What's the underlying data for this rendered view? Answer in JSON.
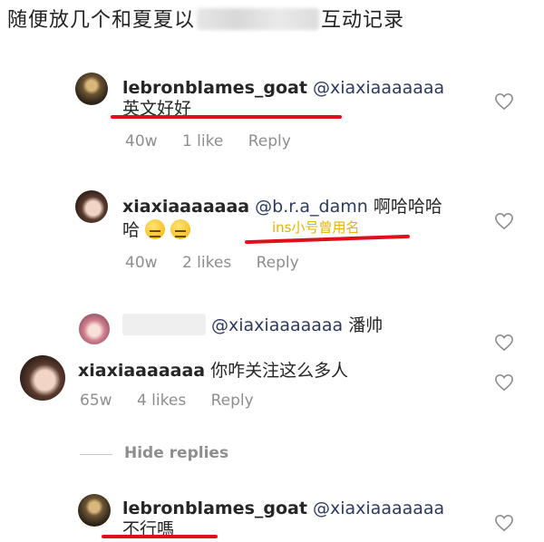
{
  "title": {
    "before": "随便放几个和夏夏以",
    "after": "互动记录"
  },
  "comments": [
    {
      "user": "lebronblames_goat",
      "mention": "@xiaxiaaaaaaa",
      "text": "英文好好",
      "age": "40w",
      "likes": "1 like",
      "reply": "Reply"
    },
    {
      "user": "xiaxiaaaaaaa",
      "mention": "@b.r.a_damn",
      "text1": "啊哈哈哈",
      "text2": "哈",
      "annotation": "ins小号曾用名",
      "age": "40w",
      "likes": "2 likes",
      "reply": "Reply"
    },
    {
      "mention": "@xiaxiaaaaaaa",
      "text": "潘帅"
    },
    {
      "user": "xiaxiaaaaaaa",
      "text": "你咋关注这么多人",
      "age": "65w",
      "likes": "4 likes",
      "reply": "Reply"
    },
    {
      "user": "lebronblames_goat",
      "mention": "@xiaxiaaaaaaa",
      "text": "不行嗎"
    }
  ],
  "hide_replies": "Hide replies",
  "colors": {
    "underline": "#e0101a",
    "annotation": "#e2b400",
    "meta": "#8e8e8e"
  },
  "icons": [
    "heart-icon",
    "emoji-icon"
  ]
}
